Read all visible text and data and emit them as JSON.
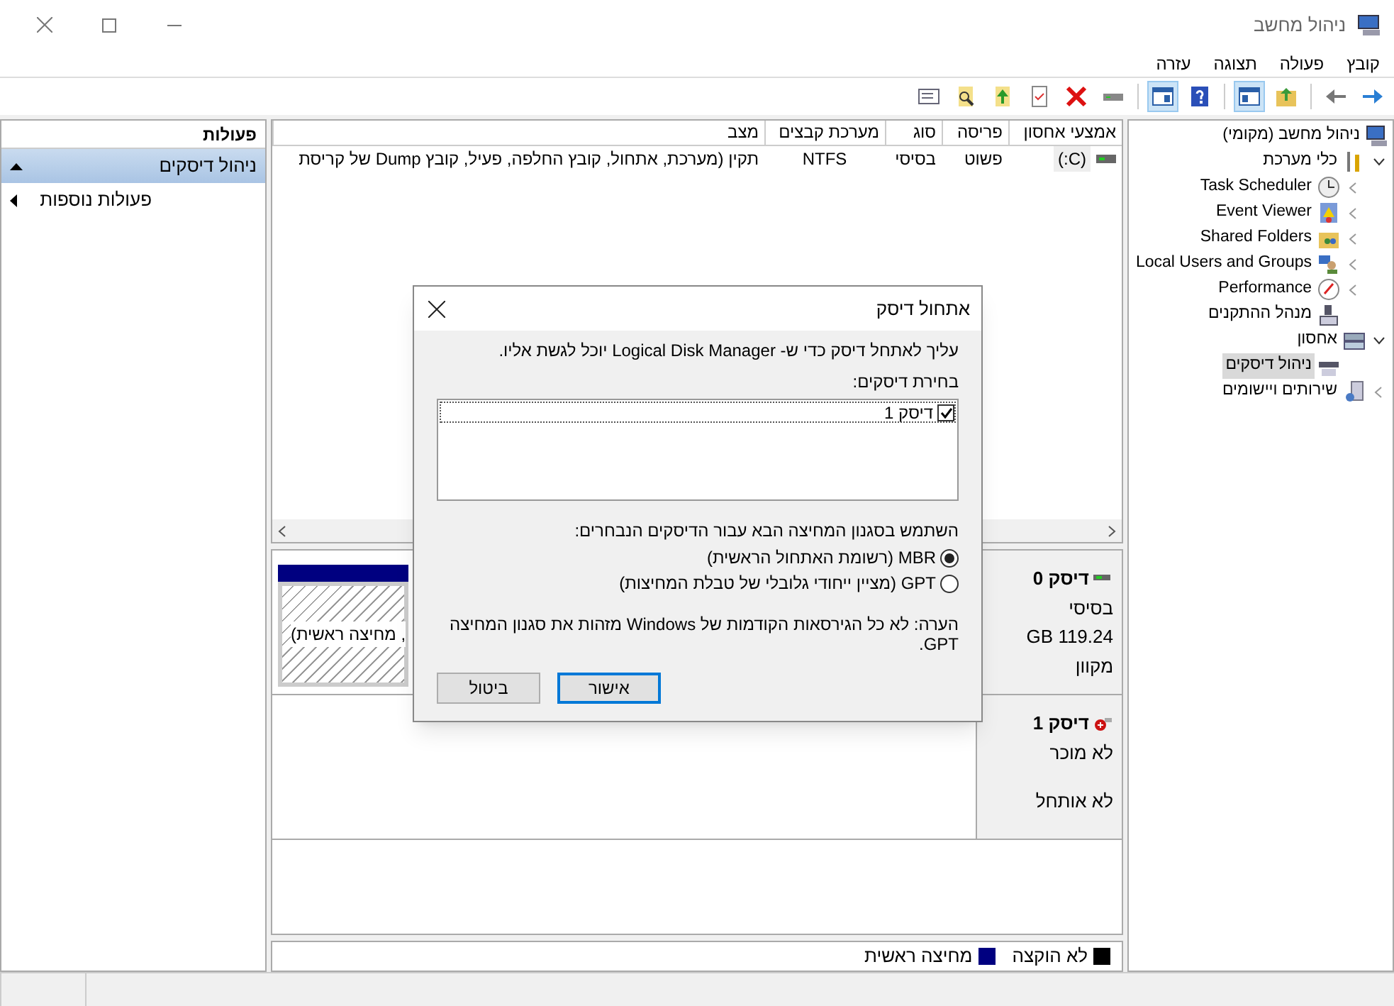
{
  "window": {
    "title": "ניהול מחשב"
  },
  "menu": [
    "קובץ",
    "פעולה",
    "תצוגה",
    "עזרה"
  ],
  "tree": {
    "label": "ניהול מחשב (מקומי)",
    "selected": false,
    "children": [
      {
        "label": "כלי מערכת",
        "selected": false,
        "expanded": true,
        "children": [
          {
            "label": "Task Scheduler",
            "selected": false,
            "expanded": false
          },
          {
            "label": "Event Viewer",
            "selected": false,
            "expanded": false
          },
          {
            "label": "Shared Folders",
            "selected": false,
            "expanded": false
          },
          {
            "label": "Local Users and Groups",
            "selected": false,
            "expanded": false
          },
          {
            "label": "Performance",
            "selected": false,
            "expanded": false
          },
          {
            "label": "מנהל ההתקנים",
            "selected": false
          }
        ]
      },
      {
        "label": "אחסון",
        "selected": false,
        "expanded": true,
        "children": [
          {
            "label": "ניהול דיסקים",
            "selected": true
          }
        ]
      },
      {
        "label": "שירותים ויישומים",
        "selected": false,
        "expanded": false
      }
    ]
  },
  "volumes": {
    "columns": [
      "אמצעי אחסון",
      "פריסה",
      "סוג",
      "מערכת קבצים",
      "מצב"
    ],
    "rows": [
      [
        "(C:)",
        "פשוט",
        "בסיסי",
        "NTFS",
        "תקין (מערכת, אתחול, קובץ החלפה, פעיל, קובץ Dump של קריסת"
      ]
    ]
  },
  "disks": [
    {
      "name": "דיסק 0",
      "kind": "online",
      "lines": [
        "בסיסי",
        "GB 119.24",
        "מקוון"
      ],
      "partition": ", מחיצה ראשית)"
    },
    {
      "name": "דיסק 1",
      "kind": "unknown",
      "lines": [
        "לא מוכר",
        "לא אותחל"
      ]
    }
  ],
  "legend": [
    {
      "label": "לא הוקצה",
      "color": "#000000"
    },
    {
      "label": "מחיצה ראשית",
      "color": "#000080"
    }
  ],
  "actions": {
    "title": "פעולות",
    "items": [
      {
        "label": "ניהול דיסקים",
        "kind": "section"
      },
      {
        "label": "פעולות נוספות",
        "kind": "item"
      }
    ]
  },
  "dialog": {
    "title": "אתחול דיסק",
    "intro": "עליך לאתחל דיסק כדי ש- Logical Disk Manager יוכל לגשת אליו.",
    "select_label": "בחירת דיסקים:",
    "disks": [
      {
        "label": "דיסק 1",
        "checked": true
      }
    ],
    "style_label": "השתמש בסגנון המחיצה הבא עבור הדיסקים הנבחרים:",
    "options": [
      {
        "label": "MBR (רשומת האתחול הראשית)",
        "selected": true
      },
      {
        "label": "GPT (מציין ייחודי גלובלי של טבלת המחיצות)",
        "selected": false
      }
    ],
    "note": "הערה: לא כל הגירסאות הקודמות של Windows מזהות את סגנון המחיצה GPT.",
    "buttons": [
      {
        "label": "אישור",
        "default": true
      },
      {
        "label": "ביטול",
        "default": false
      }
    ]
  }
}
